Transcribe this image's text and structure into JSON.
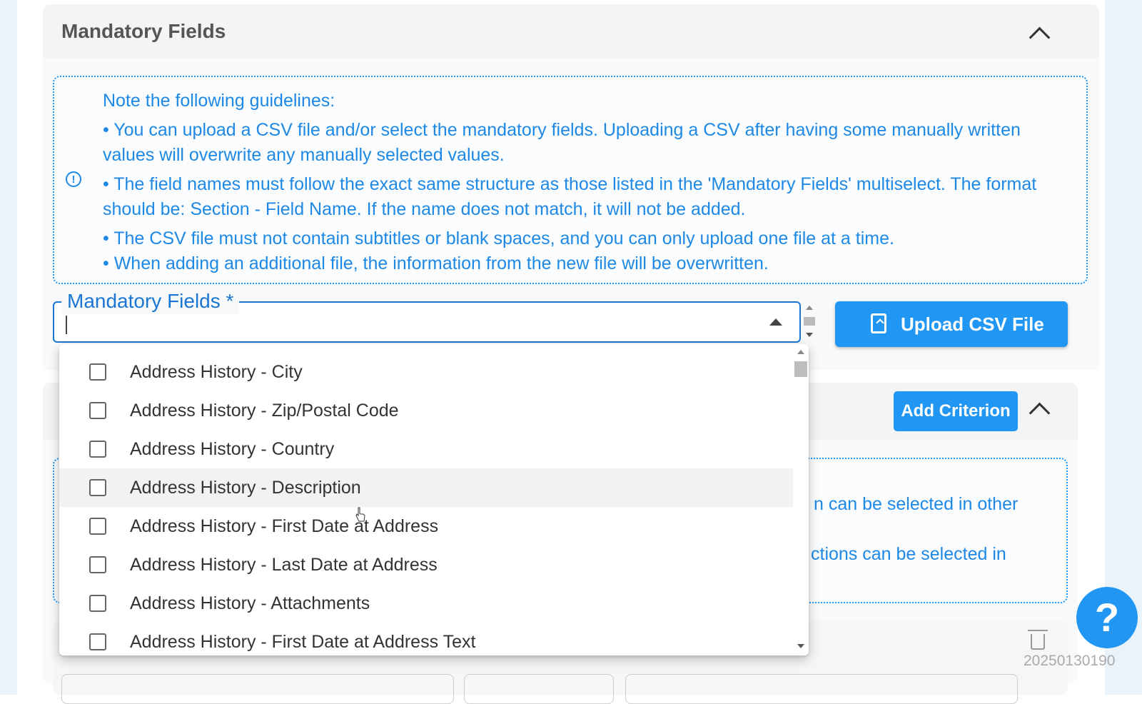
{
  "mandatory_section": {
    "title": "Mandatory Fields",
    "guidelines": {
      "heading": "Note the following guidelines:",
      "items": [
        "• You can upload a CSV file and/or select the mandatory fields. Uploading a CSV after having some manually written values will overwrite any manually selected values.",
        "• The field names must follow the exact same structure as those listed in the 'Mandatory Fields' multiselect. The format should be: Section - Field Name. If the name does not match, it will not be added.",
        "• The CSV file must not contain subtitles or blank spaces, and you can only upload one file at a time.",
        "• When adding an additional file, the information from the new file will be overwritten."
      ]
    },
    "field_label": "Mandatory Fields *",
    "upload_button": "Upload CSV File"
  },
  "dropdown": {
    "options": [
      "Address History - City",
      "Address History - Zip/Postal Code",
      "Address History - Country",
      "Address History - Description",
      "Address History - First Date at Address",
      "Address History - Last Date at Address",
      "Address History - Attachments",
      "Address History - First Date at Address Text"
    ],
    "hovered_option": "Address History - Description"
  },
  "criteria_section": {
    "add_button": "Add Criterion",
    "partial_text_1": "n can be selected in other",
    "partial_text_2": "ctions can be selected in"
  },
  "help_button": "?",
  "timestamp_fragment": "20250130190",
  "icons": {
    "collapse": "chevron-up-icon",
    "info": "info-circle-icon",
    "upload": "file-upload-icon",
    "delete": "trash-icon",
    "help": "help-icon"
  },
  "colors": {
    "primary": "#2196f3",
    "text_blue": "#1e88e5",
    "rail": "#eaf2fa"
  }
}
